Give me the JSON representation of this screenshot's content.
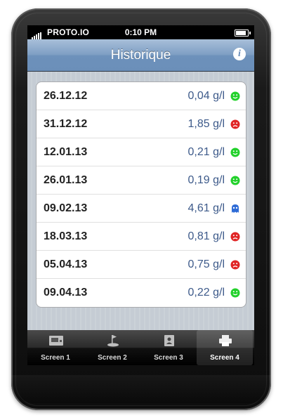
{
  "status_bar": {
    "carrier": "PROTO.IO",
    "time": "0:10 PM"
  },
  "nav": {
    "title": "Historique",
    "info_icon": "i"
  },
  "entries": [
    {
      "date": "26.12.12",
      "value": "0,04 g/l",
      "icon": "green-smiley-icon"
    },
    {
      "date": "31.12.12",
      "value": "1,85 g/l",
      "icon": "red-sad-icon"
    },
    {
      "date": "12.01.13",
      "value": "0,21 g/l",
      "icon": "green-smiley-icon"
    },
    {
      "date": "26.01.13",
      "value": "0,19 g/l",
      "icon": "green-smiley-icon"
    },
    {
      "date": "09.02.13",
      "value": "4,61 g/l",
      "icon": "blue-ghost-icon"
    },
    {
      "date": "18.03.13",
      "value": "0,81 g/l",
      "icon": "red-sad-icon"
    },
    {
      "date": "05.04.13",
      "value": "0,75 g/l",
      "icon": "red-sad-icon"
    },
    {
      "date": "09.04.13",
      "value": "0,22 g/l",
      "icon": "green-smiley-icon"
    }
  ],
  "tabs": [
    {
      "label": "Screen 1",
      "icon": "screen-icon",
      "active": false
    },
    {
      "label": "Screen 2",
      "icon": "golf-icon",
      "active": false
    },
    {
      "label": "Screen 3",
      "icon": "badge-icon",
      "active": false
    },
    {
      "label": "Screen 4",
      "icon": "printer-icon",
      "active": true
    }
  ],
  "colors": {
    "nav_top": "#a8bfd9",
    "nav_bottom": "#6b8fb9",
    "value_text": "#3d5a8a",
    "good": "#22d12b",
    "bad": "#e02424",
    "ghost": "#2e6bd6"
  }
}
